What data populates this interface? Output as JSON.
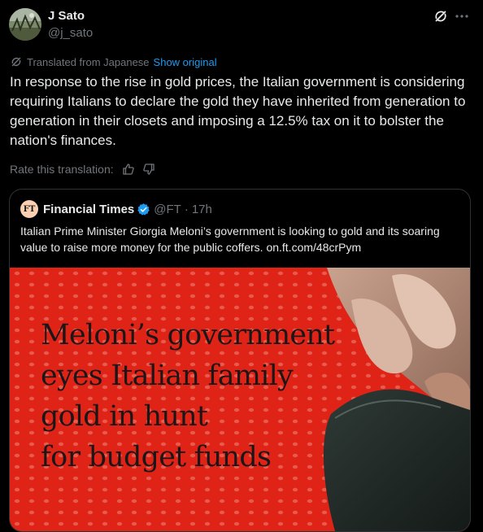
{
  "author": {
    "name": "J Sato",
    "handle": "@j_sato"
  },
  "header_icons": [
    "grok-icon",
    "more-icon"
  ],
  "translation": {
    "label": "Translated from Japanese",
    "show_original": "Show original",
    "rate_label": "Rate this translation:"
  },
  "post_text": "In response to the rise in gold prices, the Italian government is considering requiring Italians to declare the gold they have inherited from generation to generation in their closets and imposing a 12.5% tax on it to bolster the nation's finances.",
  "quote": {
    "logo_text": "FT",
    "name": "Financial Times",
    "handle": "@FT",
    "separator": "·",
    "time": "17h",
    "text": "Italian Prime Minister Giorgia Meloni’s government is looking to gold and its soaring value to raise more money for the public coffers. on.ft.com/48crPym",
    "image": {
      "headline_lines": [
        "Meloni’s government",
        "eyes Italian family",
        "gold in hunt",
        "for budget funds"
      ]
    }
  },
  "colors": {
    "background": "#000000",
    "text": "#e7e9ea",
    "muted": "#71767b",
    "link": "#1d9bf0",
    "border": "#2f3336",
    "image_red": "#e8261c"
  }
}
